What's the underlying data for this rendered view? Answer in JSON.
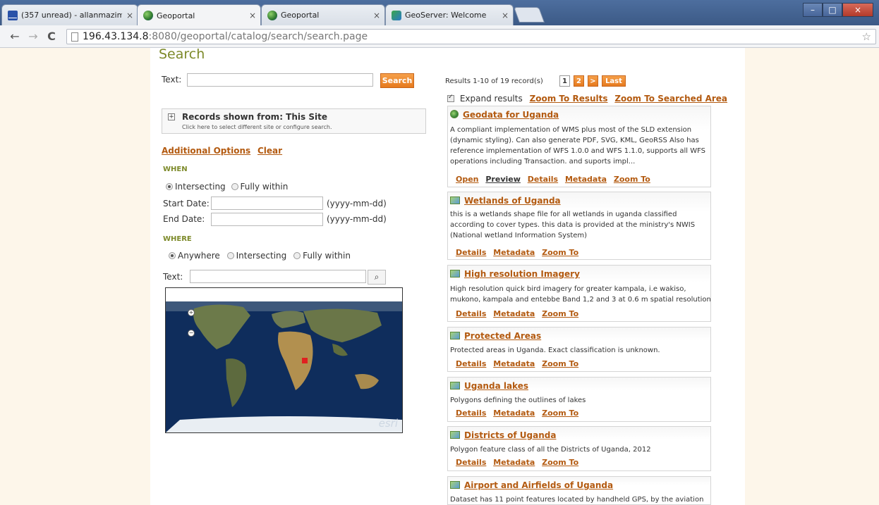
{
  "browser": {
    "tabs": [
      {
        "title": "(357 unread) - allanmazim",
        "icon": "mail-icon"
      },
      {
        "title": "Geoportal",
        "icon": "globe-icon",
        "active": true
      },
      {
        "title": "Geoportal",
        "icon": "globe-icon"
      },
      {
        "title": "GeoServer: Welcome",
        "icon": "geoserver-icon"
      }
    ],
    "close_glyph": "×",
    "url_host": "196.43.134.8",
    "url_rest": ":8080/geoportal/catalog/search/search.page",
    "back": "←",
    "forward": "→",
    "reload": "C",
    "star": "☆",
    "minimize": "–",
    "maximize": "□"
  },
  "search": {
    "title": "Search",
    "text_label": "Text:",
    "text_value": "",
    "button": "Search",
    "site_title": "Records shown from: This Site",
    "site_sub": "Click here to select different site or configure search.",
    "expand_glyph": "+",
    "additional_options": "Additional Options",
    "clear": "Clear",
    "when_header": "WHEN",
    "when_options": [
      "Intersecting",
      "Fully within"
    ],
    "start_label": "Start Date:",
    "end_label": "End Date:",
    "date_hint": "(yyyy-mm-dd)",
    "where_header": "WHERE",
    "where_options": [
      "Anywhere",
      "Intersecting",
      "Fully within"
    ],
    "where_text_label": "Text:",
    "map_attribution": "esri",
    "zoom_in": "+",
    "zoom_out": "−",
    "binoculars": "⌕"
  },
  "results": {
    "info": "Results 1-10 of 19 record(s)",
    "pages": [
      "1",
      "2",
      ">",
      "Last"
    ],
    "expand_label": "Expand results",
    "zoom_results": "Zoom To Results",
    "zoom_area": "Zoom To Searched Area",
    "items": [
      {
        "title": "Geodata for Uganda",
        "desc": "A compliant implementation of WMS plus most of the SLD extension (dynamic styling). Can also generate PDF, SVG, KML, GeoRSS Also has reference implementation of WFS 1.0.0 and WFS 1.1.0, supports all WFS operations including Transaction. and suports impl...",
        "links": [
          "Open",
          "Preview",
          "Details",
          "Metadata",
          "Zoom To"
        ]
      },
      {
        "title": "Wetlands of Uganda",
        "desc": "this is a wetlands shape file for all wetlands in uganda classified according to cover types. this data is provided at the ministry's NWIS (National wetland Information System)",
        "links": [
          "Details",
          "Metadata",
          "Zoom To"
        ]
      },
      {
        "title": "High resolution Imagery",
        "desc": "High resolution quick bird imagery for greater kampala, i.e wakiso, mukono, kampala and entebbe Band 1,2 and 3 at 0.6 m spatial resolution",
        "links": [
          "Details",
          "Metadata",
          "Zoom To"
        ]
      },
      {
        "title": "Protected Areas",
        "desc": "Protected areas in Uganda. Exact classification is unknown.",
        "links": [
          "Details",
          "Metadata",
          "Zoom To"
        ]
      },
      {
        "title": "Uganda lakes",
        "desc": "Polygons defining the outlines of lakes",
        "links": [
          "Details",
          "Metadata",
          "Zoom To"
        ]
      },
      {
        "title": "Districts of Uganda",
        "desc": "Polygon feature class of all the Districts of Uganda, 2012",
        "links": [
          "Details",
          "Metadata",
          "Zoom To"
        ]
      },
      {
        "title": "Airport and Airfields of Uganda",
        "desc": "Dataset has 11 point features located by handheld GPS, by the aviation",
        "links": []
      }
    ]
  }
}
